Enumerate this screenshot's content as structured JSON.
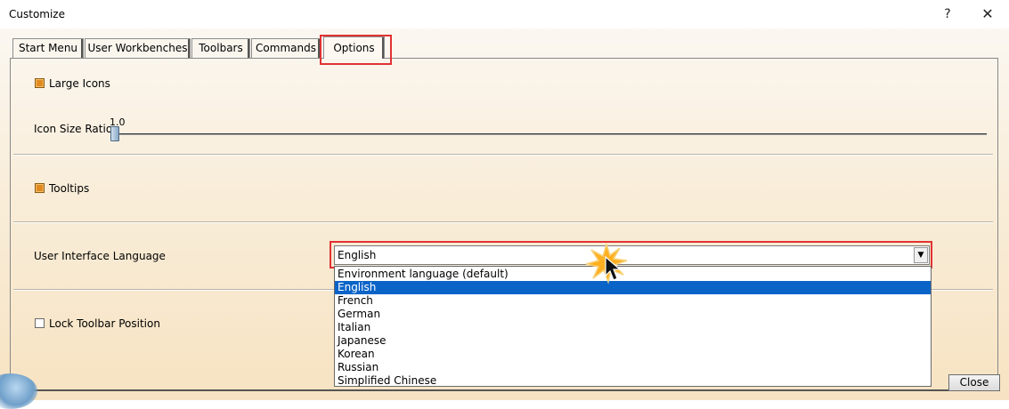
{
  "window": {
    "title": "Customize",
    "help_glyph": "?",
    "close_glyph": "✕"
  },
  "tabs": [
    {
      "label": "Start Menu",
      "active": false
    },
    {
      "label": "User Workbenches",
      "active": false
    },
    {
      "label": "Toolbars",
      "active": false
    },
    {
      "label": "Commands",
      "active": false
    },
    {
      "label": "Options",
      "active": true
    }
  ],
  "options": {
    "large_icons": {
      "label": "Large Icons",
      "checked": true
    },
    "icon_size_ratio": {
      "label": "Icon Size Ratio",
      "value": "1.0"
    },
    "tooltips": {
      "label": "Tooltips",
      "checked": true
    },
    "ui_language": {
      "label": "User Interface Language",
      "selected": "English",
      "choices": [
        "Environment language (default)",
        "English",
        "French",
        "German",
        "Italian",
        "Japanese",
        "Korean",
        "Russian",
        "Simplified Chinese"
      ],
      "highlighted_index": 1
    },
    "lock_toolbar": {
      "label": "Lock Toolbar Position",
      "checked": false
    }
  },
  "footer": {
    "close_label": "Close"
  },
  "colors": {
    "highlight_border": "#e03232",
    "selected_option_bg": "#0a64c8",
    "checkbox_checked": "#e08a20"
  }
}
